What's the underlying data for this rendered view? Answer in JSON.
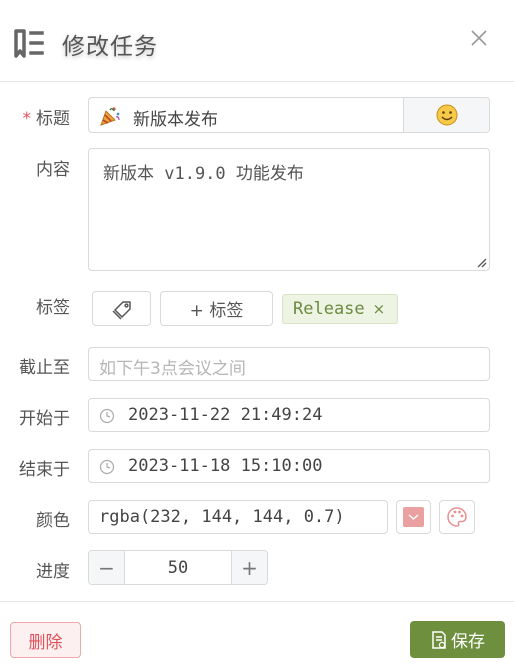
{
  "dialog": {
    "title": "修改任务",
    "header_icon": "task-list-icon",
    "close_icon": "close-icon"
  },
  "form": {
    "title": {
      "label": "标题",
      "required_mark": "*",
      "value": "新版本发布",
      "prefix_emoji": "🎉",
      "emoji_button": "😊"
    },
    "content": {
      "label": "内容",
      "value": "新版本 v1.9.0 功能发布"
    },
    "tags": {
      "label": "标签",
      "add_label": "+ 标签",
      "items": [
        {
          "text": "Release",
          "remove": "×"
        }
      ]
    },
    "deadline": {
      "label": "截止至",
      "placeholder": "如下午3点会议之间"
    },
    "start": {
      "label": "开始于",
      "value": "2023-11-22 21:49:24"
    },
    "end": {
      "label": "结束于",
      "value": "2023-11-18 15:10:00"
    },
    "color": {
      "label": "颜色",
      "value": "rgba(232, 144, 144, 0.7)",
      "swatch_color": "#e89090"
    },
    "progress": {
      "label": "进度",
      "value": "50",
      "minus": "−",
      "plus": "+"
    }
  },
  "footer": {
    "delete_label": "删除",
    "save_label": "保存"
  },
  "colors": {
    "accent": "#6e8f3e",
    "danger": "#e0525b",
    "tag_bg": "#eef4e4",
    "tag_text": "#6b8a3f"
  }
}
